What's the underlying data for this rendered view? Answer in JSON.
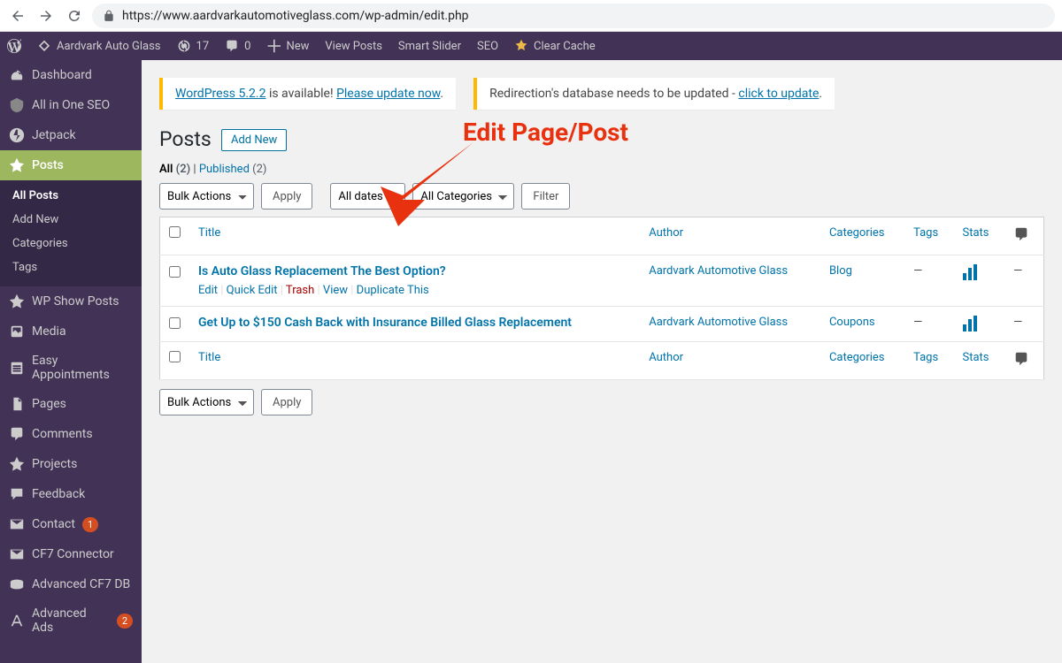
{
  "browser": {
    "url": "https://www.aardvarkautomotiveglass.com/wp-admin/edit.php"
  },
  "adminbar": {
    "site_name": "Aardvark Auto Glass",
    "updates": "17",
    "comments": "0",
    "new": "New",
    "view_posts": "View Posts",
    "smart_slider": "Smart Slider",
    "seo": "SEO",
    "clear_cache": "Clear Cache"
  },
  "sidebar": {
    "items": [
      {
        "label": "Dashboard"
      },
      {
        "label": "All in One SEO"
      },
      {
        "label": "Jetpack"
      },
      {
        "label": "Posts"
      },
      {
        "label": "WP Show Posts"
      },
      {
        "label": "Media"
      },
      {
        "label": "Easy Appointments"
      },
      {
        "label": "Pages"
      },
      {
        "label": "Comments"
      },
      {
        "label": "Projects"
      },
      {
        "label": "Feedback"
      },
      {
        "label": "Contact",
        "badge": "1"
      },
      {
        "label": "CF7 Connector"
      },
      {
        "label": "Advanced CF7 DB"
      },
      {
        "label": "Advanced Ads",
        "badge": "2"
      }
    ],
    "submenu": [
      {
        "label": "All Posts"
      },
      {
        "label": "Add New"
      },
      {
        "label": "Categories"
      },
      {
        "label": "Tags"
      }
    ]
  },
  "notices": {
    "update_prefix": "WordPress 5.2.2",
    "update_mid": " is available! ",
    "update_link": "Please update now",
    "redirection_text": "Redirection's database needs to be updated - ",
    "redirection_link": "click to update"
  },
  "page": {
    "title": "Posts",
    "add_new": "Add New"
  },
  "filters": {
    "all": "All",
    "all_count": "(2)",
    "published": "Published",
    "published_count": "(2)",
    "bulk_actions": "Bulk Actions",
    "apply": "Apply",
    "all_dates": "All dates",
    "all_categories": "All Categories",
    "filter": "Filter"
  },
  "columns": {
    "title": "Title",
    "author": "Author",
    "categories": "Categories",
    "tags": "Tags",
    "stats": "Stats"
  },
  "rows": [
    {
      "title": "Is Auto Glass Replacement The Best Option?",
      "author": "Aardvark Automotive Glass",
      "categories": "Blog",
      "tags": "—",
      "comments": "—"
    },
    {
      "title": "Get Up to $150 Cash Back with Insurance Billed Glass Replacement",
      "author": "Aardvark Automotive Glass",
      "categories": "Coupons",
      "tags": "—",
      "comments": "—"
    }
  ],
  "row_actions": {
    "edit": "Edit",
    "quick_edit": "Quick Edit",
    "trash": "Trash",
    "view": "View",
    "duplicate": "Duplicate This"
  },
  "annotation": {
    "label": "Edit Page/Post"
  }
}
